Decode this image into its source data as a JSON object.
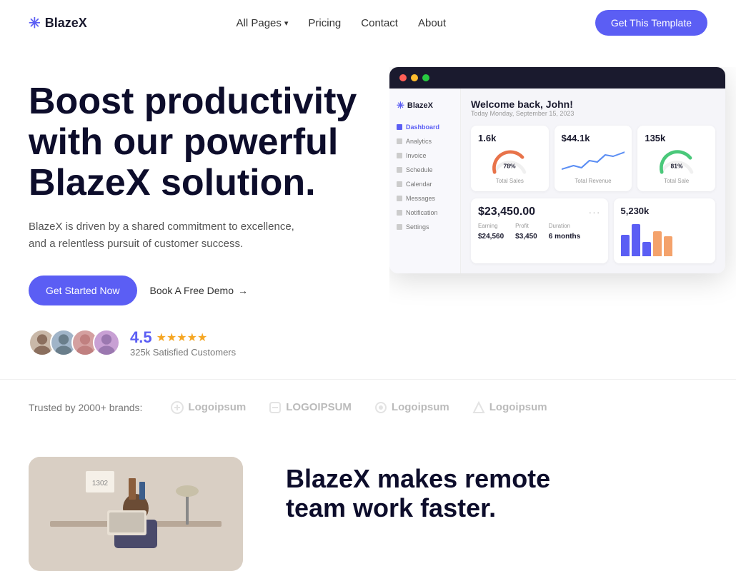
{
  "nav": {
    "logo_text": "BlazeX",
    "links": {
      "all_pages": "All Pages",
      "pricing": "Pricing",
      "contact": "Contact",
      "about": "About"
    },
    "cta": "Get This Template"
  },
  "hero": {
    "title": "Boost productivity with our powerful BlazeX solution.",
    "subtitle": "BlazeX is driven by a shared commitment to excellence, and a relentless pursuit of customer success.",
    "cta_primary": "Get Started Now",
    "cta_secondary": "Book A Free Demo",
    "rating": {
      "score": "4.5",
      "customers": "325k Satisfied Customers"
    }
  },
  "dashboard": {
    "logo": "BlazeX",
    "welcome": "Welcome back, John!",
    "date": "Today Monday, September 15, 2023",
    "nav_items": [
      "Dashboard",
      "Analytics",
      "Invoice",
      "Schedule",
      "Calendar",
      "Messages",
      "Notification",
      "Settings"
    ],
    "cards": [
      {
        "label": "1.6k",
        "sub": "Total Sales",
        "percent": 78,
        "type": "gauge"
      },
      {
        "label": "$44.1k",
        "sub": "Total Revenue",
        "type": "line"
      },
      {
        "label": "135k",
        "sub": "Total Sale",
        "percent": 81,
        "type": "gauge_partial"
      }
    ],
    "earnings": {
      "amount": "$23,450.00",
      "earning": "$24,560",
      "profit": "$3,450",
      "duration": "6 months"
    },
    "bar_card": {
      "value": "5,230k"
    }
  },
  "brands": {
    "label": "Trusted by 2000+ brands:",
    "logos": [
      "Logoipsum",
      "LOGOIPSUM",
      "Logoipsum",
      "Logoipsum"
    ]
  },
  "section2": {
    "title_line1": "BlazeX makes remote",
    "title_line2": "team work faster."
  }
}
